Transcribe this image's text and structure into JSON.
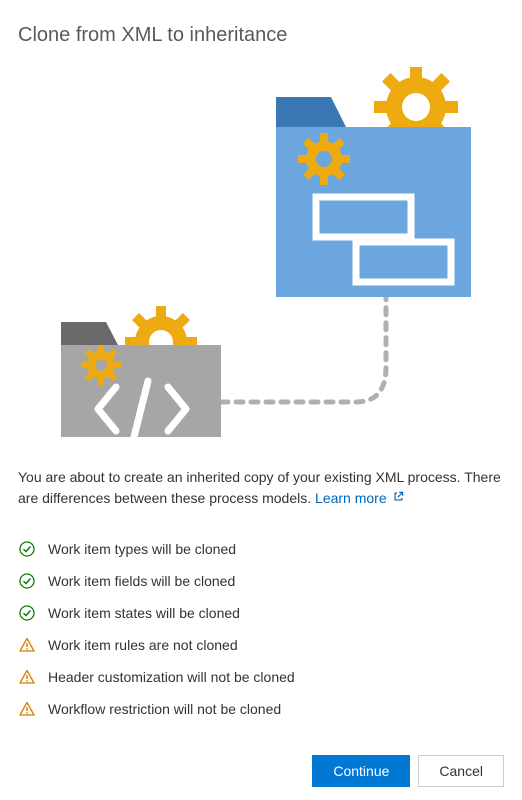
{
  "title": "Clone from XML to inheritance",
  "description_text": "You are about to create an inherited copy of your existing XML process. There are differences between these process models. ",
  "learn_more_label": "Learn more",
  "checklist": [
    {
      "icon": "success",
      "text": "Work item types will be cloned"
    },
    {
      "icon": "success",
      "text": "Work item fields will be cloned"
    },
    {
      "icon": "success",
      "text": "Work item states will be cloned"
    },
    {
      "icon": "warning",
      "text": "Work item rules are not cloned"
    },
    {
      "icon": "warning",
      "text": "Header customization will not be cloned"
    },
    {
      "icon": "warning",
      "text": "Workflow restriction will not be cloned"
    }
  ],
  "buttons": {
    "continue": "Continue",
    "cancel": "Cancel"
  }
}
